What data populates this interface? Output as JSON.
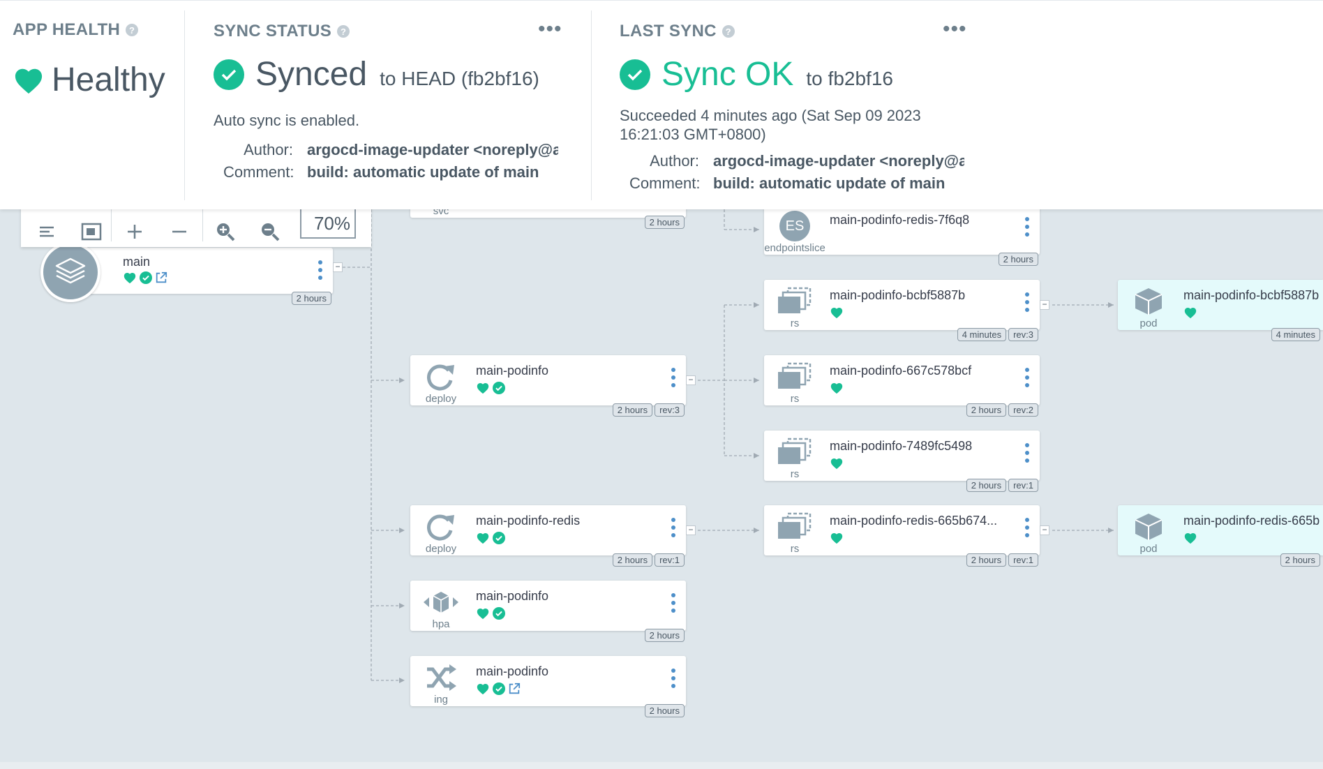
{
  "status": {
    "health": {
      "title": "APP HEALTH",
      "value": "Healthy"
    },
    "sync": {
      "title": "SYNC STATUS",
      "value": "Synced",
      "target": "to HEAD (fb2bf16)",
      "auto": "Auto sync is enabled.",
      "author_label": "Author:",
      "author": "argocd-image-updater <noreply@a...",
      "comment_label": "Comment:",
      "comment": "build: automatic update of main"
    },
    "last": {
      "title": "LAST SYNC",
      "value": "Sync OK",
      "target": "to fb2bf16",
      "time_line1": "Succeeded 4 minutes ago (Sat Sep 09 2023",
      "time_line2": "16:21:03 GMT+0800)",
      "author_label": "Author:",
      "author": "argocd-image-updater <noreply@a...",
      "comment_label": "Comment:",
      "comment": "build: automatic update of main"
    }
  },
  "toolbar": {
    "zoom": "70%"
  },
  "root": {
    "name": "main",
    "age": "2 hours"
  },
  "svc_partial": {
    "kind": "svc",
    "age": "2 hours"
  },
  "nodes": {
    "es": {
      "kind": "endpointslice",
      "icon_text": "ES",
      "name": "main-podinfo-redis-7f6q8",
      "age": "2 hours"
    },
    "deploy1": {
      "kind": "deploy",
      "name": "main-podinfo",
      "age": "2 hours",
      "rev": "rev:3"
    },
    "deploy2": {
      "kind": "deploy",
      "name": "main-podinfo-redis",
      "age": "2 hours",
      "rev": "rev:1"
    },
    "hpa": {
      "kind": "hpa",
      "name": "main-podinfo",
      "age": "2 hours"
    },
    "ing": {
      "kind": "ing",
      "name": "main-podinfo",
      "age": "2 hours"
    },
    "rs1": {
      "kind": "rs",
      "name": "main-podinfo-bcbf5887b",
      "age": "4 minutes",
      "rev": "rev:3"
    },
    "rs2": {
      "kind": "rs",
      "name": "main-podinfo-667c578bcf",
      "age": "2 hours",
      "rev": "rev:2"
    },
    "rs3": {
      "kind": "rs",
      "name": "main-podinfo-7489fc5498",
      "age": "2 hours",
      "rev": "rev:1"
    },
    "rs4": {
      "kind": "rs",
      "name": "main-podinfo-redis-665b674...",
      "age": "2 hours",
      "rev": "rev:1"
    },
    "pod1": {
      "kind": "pod",
      "name": "main-podinfo-bcbf5887b",
      "age": "4 minutes"
    },
    "pod2": {
      "kind": "pod",
      "name": "main-podinfo-redis-665b",
      "age": "2 hours"
    }
  },
  "colors": {
    "healthy": "#18be94",
    "link": "#4d8fc9",
    "icon_grey": "#8fa4b1"
  }
}
